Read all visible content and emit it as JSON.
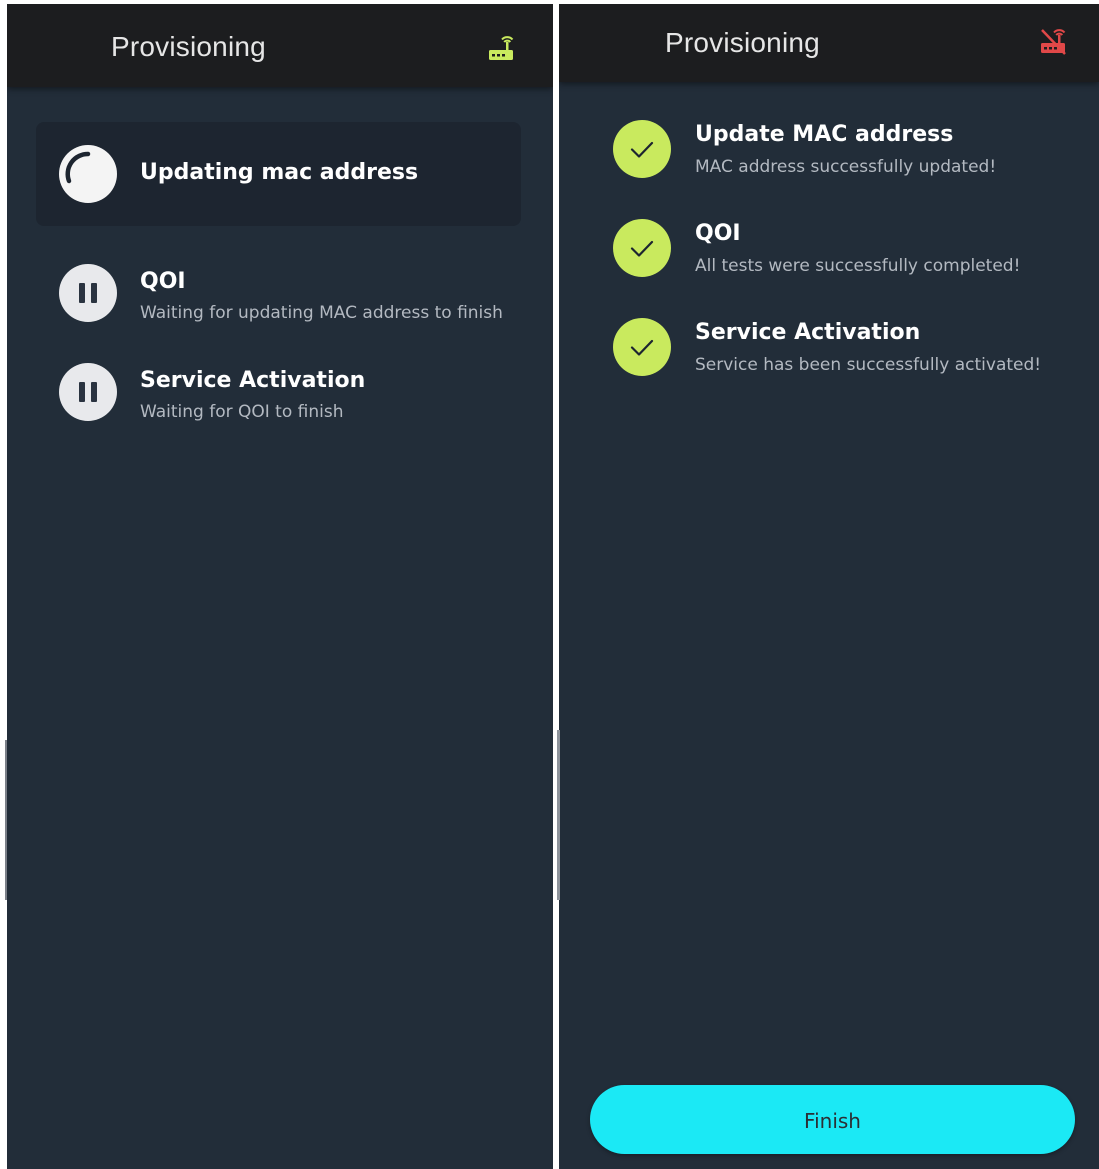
{
  "screens": [
    {
      "title": "Provisioning",
      "router_status": "connected",
      "steps": [
        {
          "title": "Updating mac address",
          "subtitle": "",
          "state": "in-progress"
        },
        {
          "title": "QOI",
          "subtitle": "Waiting for updating MAC address to finish",
          "state": "waiting"
        },
        {
          "title": "Service Activation",
          "subtitle": "Waiting for QOI to finish",
          "state": "waiting"
        }
      ]
    },
    {
      "title": "Provisioning",
      "router_status": "disconnected",
      "steps": [
        {
          "title": "Update MAC address",
          "subtitle": "MAC address successfully updated!",
          "state": "done"
        },
        {
          "title": "QOI",
          "subtitle": "All tests were successfully completed!",
          "state": "done"
        },
        {
          "title": "Service Activation",
          "subtitle": "Service has been successfully activated!",
          "state": "done"
        }
      ],
      "finish_label": "Finish"
    }
  ],
  "colors": {
    "background": "#222d39",
    "appbar": "#1c1d1f",
    "success": "#c9ea5e",
    "router_connected": "#c9ea5e",
    "router_disconnected": "#e04848",
    "finish_button": "#1be9f5"
  },
  "icons": {
    "router_connected": "router-wifi-icon",
    "router_disconnected": "router-wifi-off-icon",
    "in_progress": "spinner-icon",
    "waiting": "pause-icon",
    "done": "check-icon"
  }
}
